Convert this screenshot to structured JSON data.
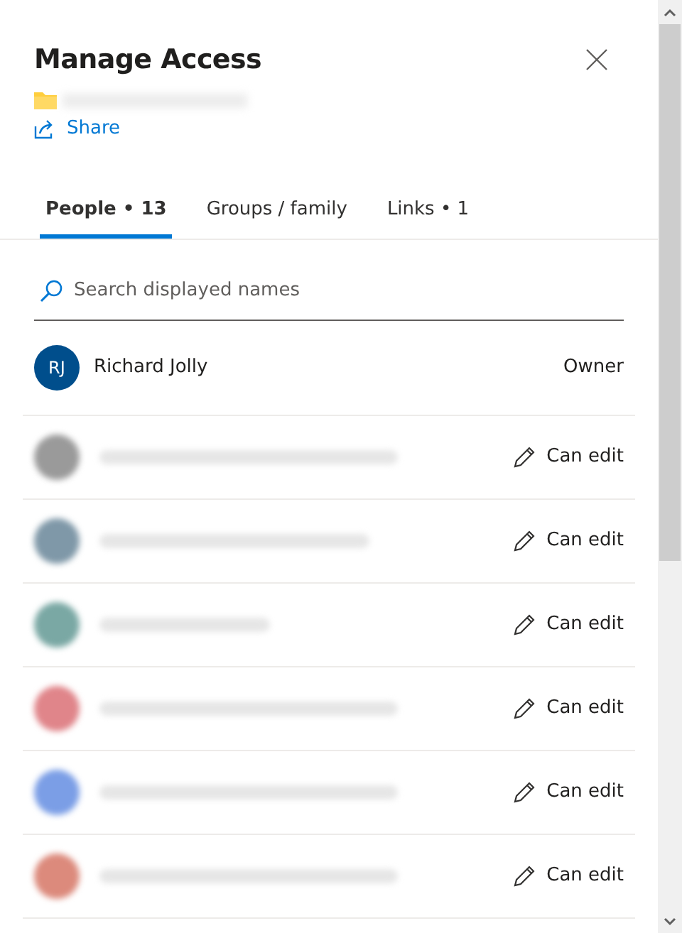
{
  "panel": {
    "title": "Manage Access",
    "share_label": "Share"
  },
  "tabs": [
    {
      "label": "People • 13",
      "selected": true
    },
    {
      "label": "Groups / family",
      "selected": false
    },
    {
      "label": "Links • 1",
      "selected": false
    }
  ],
  "search": {
    "placeholder": "Search displayed names"
  },
  "owner": {
    "initials": "RJ",
    "name": "Richard Jolly",
    "role": "Owner",
    "color": "#004e8c"
  },
  "people": [
    {
      "color": "#9a9a9a",
      "permission": "Can edit"
    },
    {
      "color": "#7f98a8",
      "permission": "Can edit"
    },
    {
      "color": "#7aa8a4",
      "permission": "Can edit"
    },
    {
      "color": "#e0858a",
      "permission": "Can edit"
    },
    {
      "color": "#7b9ee6",
      "permission": "Can edit"
    },
    {
      "color": "#dc8a7c",
      "permission": "Can edit"
    }
  ]
}
